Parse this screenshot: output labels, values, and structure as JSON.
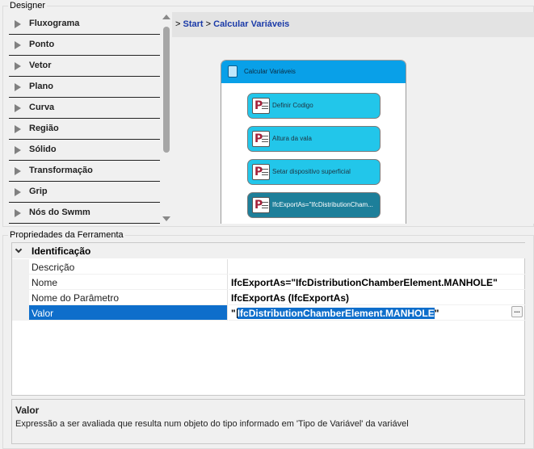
{
  "designer": {
    "title": "Designer"
  },
  "toolbox": {
    "items": [
      {
        "label": "Fluxograma"
      },
      {
        "label": "Ponto"
      },
      {
        "label": "Vetor"
      },
      {
        "label": "Plano"
      },
      {
        "label": "Curva"
      },
      {
        "label": "Região"
      },
      {
        "label": "Sólido"
      },
      {
        "label": "Transformação"
      },
      {
        "label": "Grip"
      },
      {
        "label": "Nós do Swmm"
      }
    ]
  },
  "breadcrumb": {
    "prefix": ">",
    "items": [
      "Start",
      "Calcular Variáveis"
    ],
    "separator": ">"
  },
  "activity": {
    "title": "Calcular Variáveis",
    "steps": [
      {
        "label": "Definir Codigo"
      },
      {
        "label": "Altura da vala"
      },
      {
        "label": "Setar dispositivo superficial"
      },
      {
        "label": "IfcExportAs=\"IfcDistributionCham..."
      }
    ]
  },
  "properties": {
    "title": "Propriedades da Ferramenta",
    "category": "Identificação",
    "rows": [
      {
        "name": "Descrição",
        "value": ""
      },
      {
        "name": "Nome",
        "value": "IfcExportAs=\"IfcDistributionChamberElement.MANHOLE\""
      },
      {
        "name": "Nome do Parâmetro",
        "value": "IfcExportAs (IfcExportAs)"
      },
      {
        "name": "Valor",
        "value_prefix": "\"",
        "value_selected": "IfcDistributionChamberElement.MANHOLE",
        "value_suffix": "\""
      }
    ],
    "ellipsis": "..."
  },
  "description": {
    "title": "Valor",
    "text": "Expressão a ser avaliada que resulta num objeto do tipo informado em 'Tipo de Variável' da variável"
  },
  "colors": {
    "header_blue": "#09a0e8",
    "step_light": "#22c6ea",
    "step_dark": "#1d7f9a",
    "selection": "#0e6ecb"
  }
}
